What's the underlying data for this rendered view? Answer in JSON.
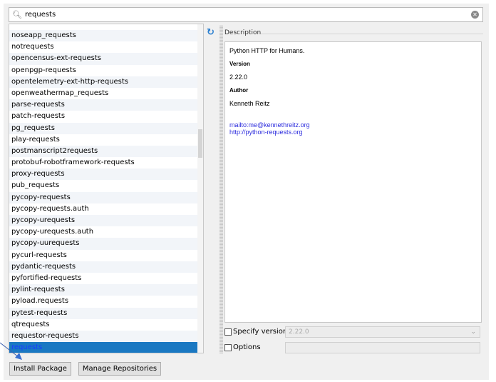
{
  "search": {
    "value": "requests",
    "icon": "search-icon",
    "clear_icon": "clear-icon"
  },
  "packages": [
    "noseapp_requests",
    "notrequests",
    "opencensus-ext-requests",
    "openpgp-requests",
    "opentelemetry-ext-http-requests",
    "openweathermap_requests",
    "parse-requests",
    "patch-requests",
    "pg_requests",
    "play-requests",
    "postmanscript2requests",
    "protobuf-robotframework-requests",
    "proxy-requests",
    "pub_requests",
    "pycopy-requests",
    "pycopy-requests.auth",
    "pycopy-urequests",
    "pycopy-urequests.auth",
    "pycopy-uurequests",
    "pycurl-requests",
    "pydantic-requests",
    "pyfortified-requests",
    "pylint-requests",
    "pyload.requests",
    "pytest-requests",
    "qtrequests",
    "requestor-requests",
    "requests"
  ],
  "selected": "requests",
  "description": {
    "label": "Description",
    "summary": "Python HTTP for Humans.",
    "version_label": "Version",
    "version": "2.22.0",
    "author_label": "Author",
    "author": "Kenneth Reitz",
    "email_link": "mailto:me@kennethreitz.org",
    "url_link": "http://python-requests.org"
  },
  "options": {
    "specify_version_label": "Specify version",
    "specify_version_value": "2.22.0",
    "options_label": "Options"
  },
  "buttons": {
    "install": "Install Package",
    "manage": "Manage Repositories"
  },
  "colors": {
    "selection": "#1a78c2",
    "link": "#2b2bdd"
  }
}
